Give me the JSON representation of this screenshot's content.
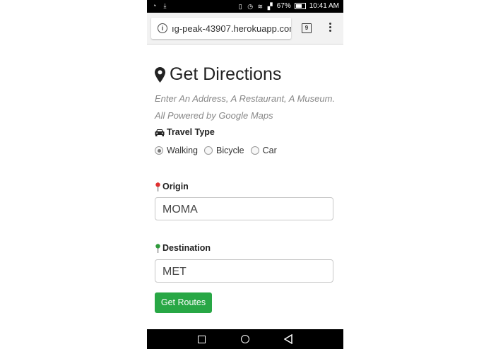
{
  "status_bar": {
    "battery": "67%",
    "time": "10:41 AM"
  },
  "browser": {
    "url": "ıg-peak-43907.herokuapp.com",
    "tab_count": "9"
  },
  "page": {
    "title": "Get Directions",
    "subtitle_1": "Enter An Address, A Restaurant, A Museum.",
    "subtitle_2": "All Powered by Google Maps",
    "travel_type_label": "Travel Type",
    "travel_options": [
      {
        "label": "Walking",
        "checked": true
      },
      {
        "label": "Bicycle",
        "checked": false
      },
      {
        "label": "Car",
        "checked": false
      }
    ],
    "origin_label": "Origin",
    "origin_value": "MOMA",
    "destination_label": "Destination",
    "destination_value": "MET",
    "submit_label": "Get Routes"
  },
  "colors": {
    "button_green": "#28a745",
    "origin_pin": "#e03030",
    "destination_pin": "#2e9a3a"
  }
}
